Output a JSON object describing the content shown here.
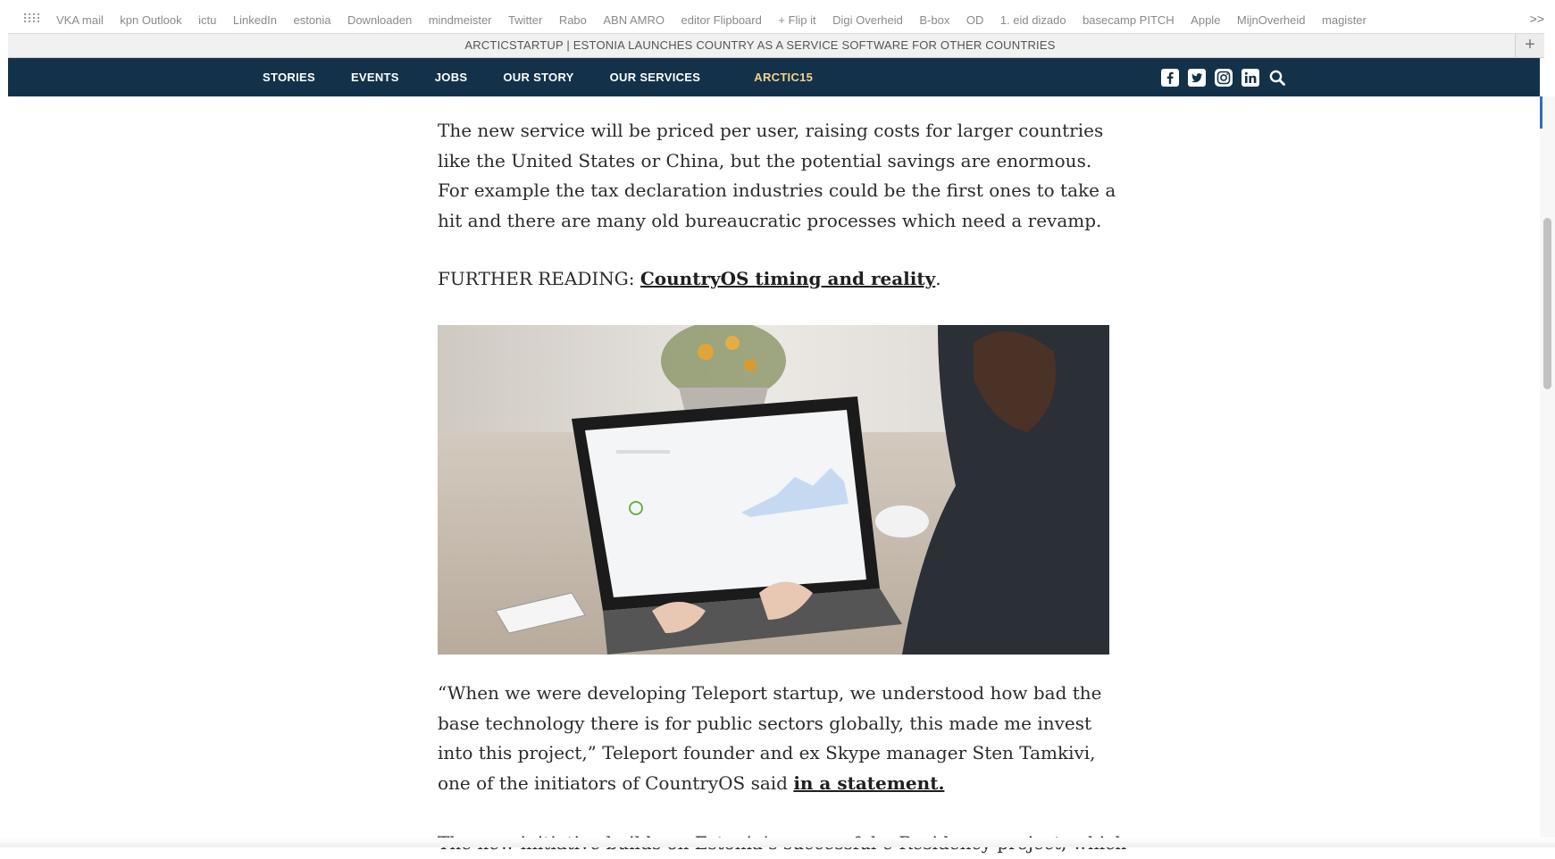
{
  "bookmarks": {
    "items": [
      "VKA mail",
      "kpn Outlook",
      "ictu",
      "LinkedIn",
      "estonia",
      "Downloaden",
      "mindmeister",
      "Twitter",
      "Rabo",
      "ABN AMRO",
      "editor Flipboard",
      "+ Flip it",
      "Digi Overheid",
      "B-box",
      "OD",
      "1. eid dizado",
      "basecamp PITCH",
      "Apple",
      "MijnOverheid",
      "magister"
    ],
    "more": ">>"
  },
  "tab": {
    "title": "ARCTICSTARTUP | ESTONIA LAUNCHES COUNTRY AS A SERVICE SOFTWARE FOR OTHER COUNTRIES",
    "new_tab": "+"
  },
  "nav": {
    "links": [
      "STORIES",
      "EVENTS",
      "JOBS",
      "OUR STORY",
      "OUR SERVICES"
    ],
    "accent_link": "ARCTIC15",
    "accent_color": "#f2d38a",
    "background": "#13324a",
    "social_icons": [
      "facebook-icon",
      "twitter-icon",
      "instagram-icon",
      "linkedin-icon",
      "search-icon"
    ]
  },
  "article": {
    "p1": "The new service will be priced per user, raising costs for larger countries like the United States or China, but the potential savings are enormous. For example the tax declaration industries could be the first ones to take a hit and there are many old bureaucratic processes which need a revamp.",
    "p2_prefix": "FURTHER READING: ",
    "p2_link": "CountryOS timing and reality",
    "p2_suffix": ".",
    "p3_text": "“When we were developing Teleport startup, we understood how bad the base technology there is for public sectors globally, this made me invest into this project,” Teleport founder and ex Skype manager Sten Tamkivi, one of the initiators of CountryOS said ",
    "p3_link": "in a statement.",
    "p4": "The new initiative builds on Estonia’s successful e-Residency project, which"
  }
}
